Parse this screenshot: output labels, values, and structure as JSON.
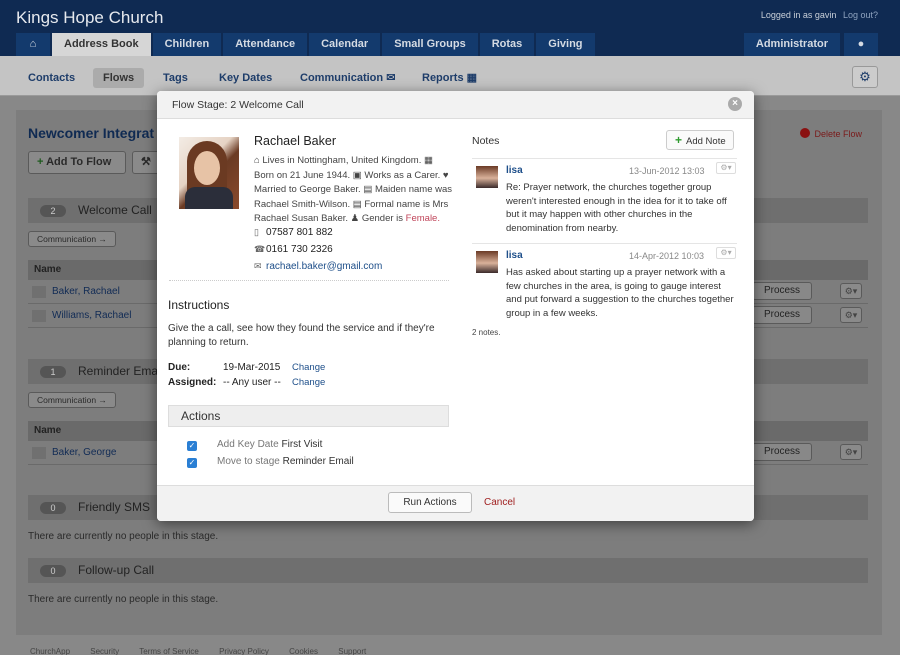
{
  "app": {
    "title": "Kings Hope Church",
    "logged_in": "Logged in as gavin",
    "logout": "Log out?"
  },
  "main_tabs": [
    {
      "label": "Address Book"
    },
    {
      "label": "Children"
    },
    {
      "label": "Attendance"
    },
    {
      "label": "Calendar"
    },
    {
      "label": "Small Groups"
    },
    {
      "label": "Rotas"
    },
    {
      "label": "Giving"
    }
  ],
  "right_tabs": {
    "admin": "Administrator"
  },
  "sub_tabs": [
    "Contacts",
    "Flows",
    "Tags",
    "Key Dates",
    "Communication",
    "Reports"
  ],
  "page": {
    "title": "Newcomer Integrat",
    "delete_flow": "Delete Flow",
    "add_to_flow": "Add To Flow",
    "stages": [
      {
        "count": "2",
        "name": "Welcome Call"
      },
      {
        "count": "1",
        "name": "Reminder Ema"
      },
      {
        "count": "0",
        "name": "Friendly SMS"
      },
      {
        "count": "0",
        "name": "Follow-up Call"
      }
    ],
    "communication_btn": "Communication →",
    "name_col": "Name",
    "process_btn": "Process",
    "people_stage1": [
      "Baker, Rachael",
      "Williams, Rachael"
    ],
    "people_stage2": [
      "Baker, George"
    ],
    "no_people": "There are currently no people in this stage.",
    "footer": [
      "ChurchApp",
      "Security",
      "Terms of Service",
      "Privacy Policy",
      "Cookies",
      "Support"
    ]
  },
  "modal": {
    "title": "Flow Stage: 2 Welcome Call",
    "person": {
      "name": "Rachael Baker",
      "desc_1": "Lives in Nottingham, United Kingdom.",
      "desc_2": "Born on 21 June 1944.",
      "desc_3": "Works as a Carer.",
      "desc_4": "Married to George Baker.",
      "desc_5": "Maiden name was Rachael Smith-Wilson.",
      "desc_6": "Formal name is Mrs Rachael Susan Baker.",
      "gender_label": "Gender is",
      "gender": "Female.",
      "mobile": "07587 801 882",
      "phone": "0161 730 2326",
      "email": "rachael.baker@gmail.com"
    },
    "instructions": {
      "heading": "Instructions",
      "text": "Give the a call, see how they found the service and if they're planning to return.",
      "due_label": "Due:",
      "due_value": "19-Mar-2015",
      "assigned_label": "Assigned:",
      "assigned_value": "-- Any user --",
      "change": "Change"
    },
    "actions": {
      "heading": "Actions",
      "items": [
        {
          "prefix": "Add Key Date",
          "value": "First Visit",
          "checked": true
        },
        {
          "prefix": "Move to stage",
          "value": "Reminder Email",
          "checked": true
        }
      ]
    },
    "notes": {
      "heading": "Notes",
      "add_note": "Add Note",
      "items": [
        {
          "user": "lisa",
          "date": "13-Jun-2012 13:03",
          "text": "Re: Prayer network, the churches together group weren't interested enough in the idea for it to take off but it may happen with other churches in the denomination from nearby."
        },
        {
          "user": "lisa",
          "date": "14-Apr-2012 10:03",
          "text": "Has asked about starting up a prayer network with a few churches in the area, is going to gauge interest and put forward a suggestion to the churches together group in a few weeks."
        }
      ],
      "count": "2 notes."
    },
    "run_actions": "Run Actions",
    "cancel": "Cancel"
  }
}
